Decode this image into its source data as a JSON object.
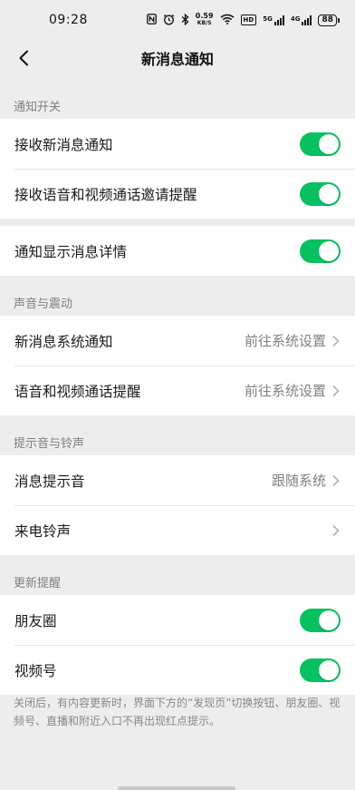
{
  "status_bar": {
    "time": "09:28",
    "icons": [
      "nfc-icon",
      "alarm-icon",
      "bluetooth-icon"
    ],
    "net_speed_value": "0.59",
    "net_speed_unit": "KB/S",
    "hd_label": "HD",
    "sig1_label": "5G",
    "sig2_label": "4G",
    "battery": "88"
  },
  "nav": {
    "title": "新消息通知"
  },
  "sections": {
    "notify_switch": "通知开关",
    "sound_vibration": "声音与震动",
    "tone_ringtone": "提示音与铃声",
    "update_reminder": "更新提醒"
  },
  "rows": {
    "receive_new": "接收新消息通知",
    "receive_call_invite": "接收语音和视频通话邀请提醒",
    "show_details": "通知显示消息详情",
    "system_notify": "新消息系统通知",
    "system_notify_value": "前往系统设置",
    "call_reminder": "语音和视频通话提醒",
    "call_reminder_value": "前往系统设置",
    "message_tone": "消息提示音",
    "message_tone_value": "跟随系统",
    "ringtone": "来电铃声",
    "moments": "朋友圈",
    "channels": "视频号"
  },
  "toggles": {
    "receive_new": true,
    "receive_call_invite": true,
    "show_details": true,
    "moments": true,
    "channels": true
  },
  "footer": {
    "note": "关闭后，有内容更新时，界面下方的“发现页”切换按钮、朋友圈、视频号、直播和附近入口不再出现红点提示。"
  },
  "colors": {
    "accent": "#07c160",
    "background": "#ededed",
    "secondary_text": "#808080"
  }
}
